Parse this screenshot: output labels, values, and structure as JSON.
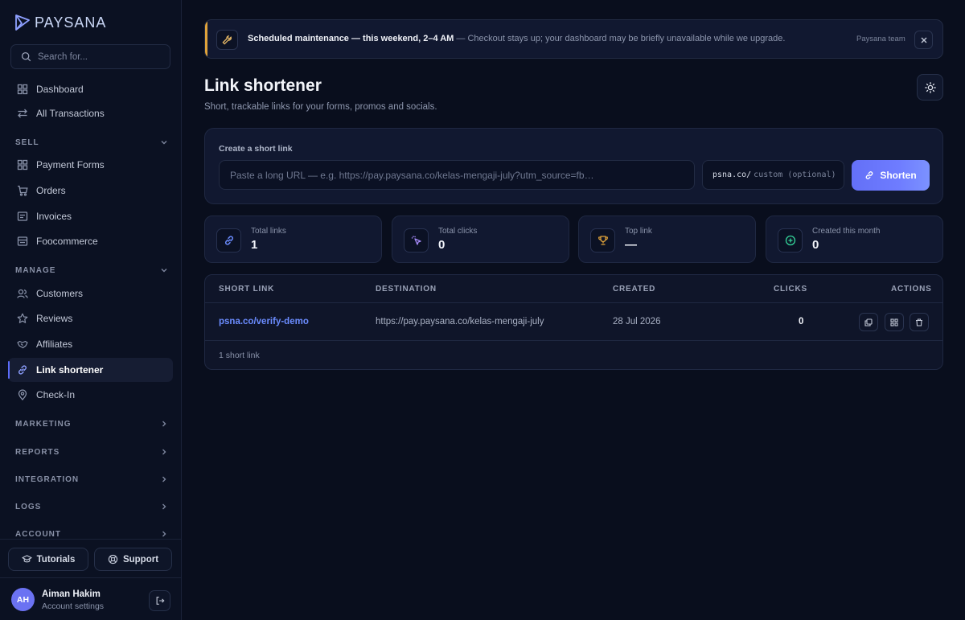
{
  "brand": {
    "name": "PAYSANA"
  },
  "sidebar": {
    "search_placeholder": "Search for...",
    "top_items": [
      {
        "label": "Dashboard",
        "icon": "grid-icon"
      },
      {
        "label": "All Transactions",
        "icon": "swap-icon"
      }
    ],
    "sections": [
      {
        "label": "SELL",
        "state": "expanded"
      },
      {
        "label": "MANAGE",
        "state": "expanded"
      },
      {
        "label": "MARKETING",
        "state": "collapsed"
      },
      {
        "label": "REPORTS",
        "state": "collapsed"
      },
      {
        "label": "INTEGRATION",
        "state": "collapsed"
      },
      {
        "label": "LOGS",
        "state": "collapsed"
      },
      {
        "label": "ACCOUNT",
        "state": "collapsed"
      }
    ],
    "sell_items": [
      {
        "label": "Payment Forms",
        "icon": "grid-icon"
      },
      {
        "label": "Orders",
        "icon": "cart-icon"
      },
      {
        "label": "Invoices",
        "icon": "invoice-icon"
      },
      {
        "label": "Foocommerce",
        "icon": "store-icon"
      }
    ],
    "manage_items": [
      {
        "label": "Customers",
        "icon": "users-icon"
      },
      {
        "label": "Reviews",
        "icon": "star-icon"
      },
      {
        "label": "Affiliates",
        "icon": "handshake-icon"
      },
      {
        "label": "Link shortener",
        "icon": "link-icon",
        "active": true
      },
      {
        "label": "Check-In",
        "icon": "pin-icon"
      }
    ],
    "bottom": {
      "tutorials": "Tutorials",
      "support": "Support"
    },
    "user": {
      "initials": "AH",
      "name": "Aiman Hakim",
      "subtitle": "Account settings"
    }
  },
  "banner": {
    "title": "Scheduled maintenance — this weekend, 2–4 AM",
    "message": "— Checkout stays up; your dashboard may be briefly unavailable while we upgrade.",
    "team": "Paysana team",
    "accent": "#e0a33a"
  },
  "page": {
    "title": "Link shortener",
    "subtitle": "Short, trackable links for your forms, promos and socials."
  },
  "create": {
    "label": "Create a short link",
    "url_placeholder": "Paste a long URL — e.g. https://pay.paysana.co/kelas-mengaji-july?utm_source=fb…",
    "slug_prefix": "psna.co/",
    "slug_placeholder": "custom (optional)",
    "button": "Shorten",
    "button_color": "#6470f7"
  },
  "stats": [
    {
      "label": "Total links",
      "value": "1",
      "icon": "link-icon",
      "color": "#6b8cff"
    },
    {
      "label": "Total clicks",
      "value": "0",
      "icon": "cursor-click-icon",
      "color": "#a78bfa"
    },
    {
      "label": "Top link",
      "value": "—",
      "icon": "trophy-icon",
      "color": "#e0a33a"
    },
    {
      "label": "Created this month",
      "value": "0",
      "icon": "plus-circle-icon",
      "color": "#34d399"
    }
  ],
  "table": {
    "columns": [
      "SHORT LINK",
      "DESTINATION",
      "CREATED",
      "CLICKS",
      "ACTIONS"
    ],
    "rows": [
      {
        "short_link": "psna.co/verify-demo",
        "destination": "https://pay.paysana.co/kelas-mengaji-july",
        "created": "28 Jul 2026",
        "clicks": "0",
        "actions": [
          "copy-icon",
          "qr-code-icon",
          "trash-icon"
        ]
      }
    ],
    "footer": "1 short link"
  }
}
